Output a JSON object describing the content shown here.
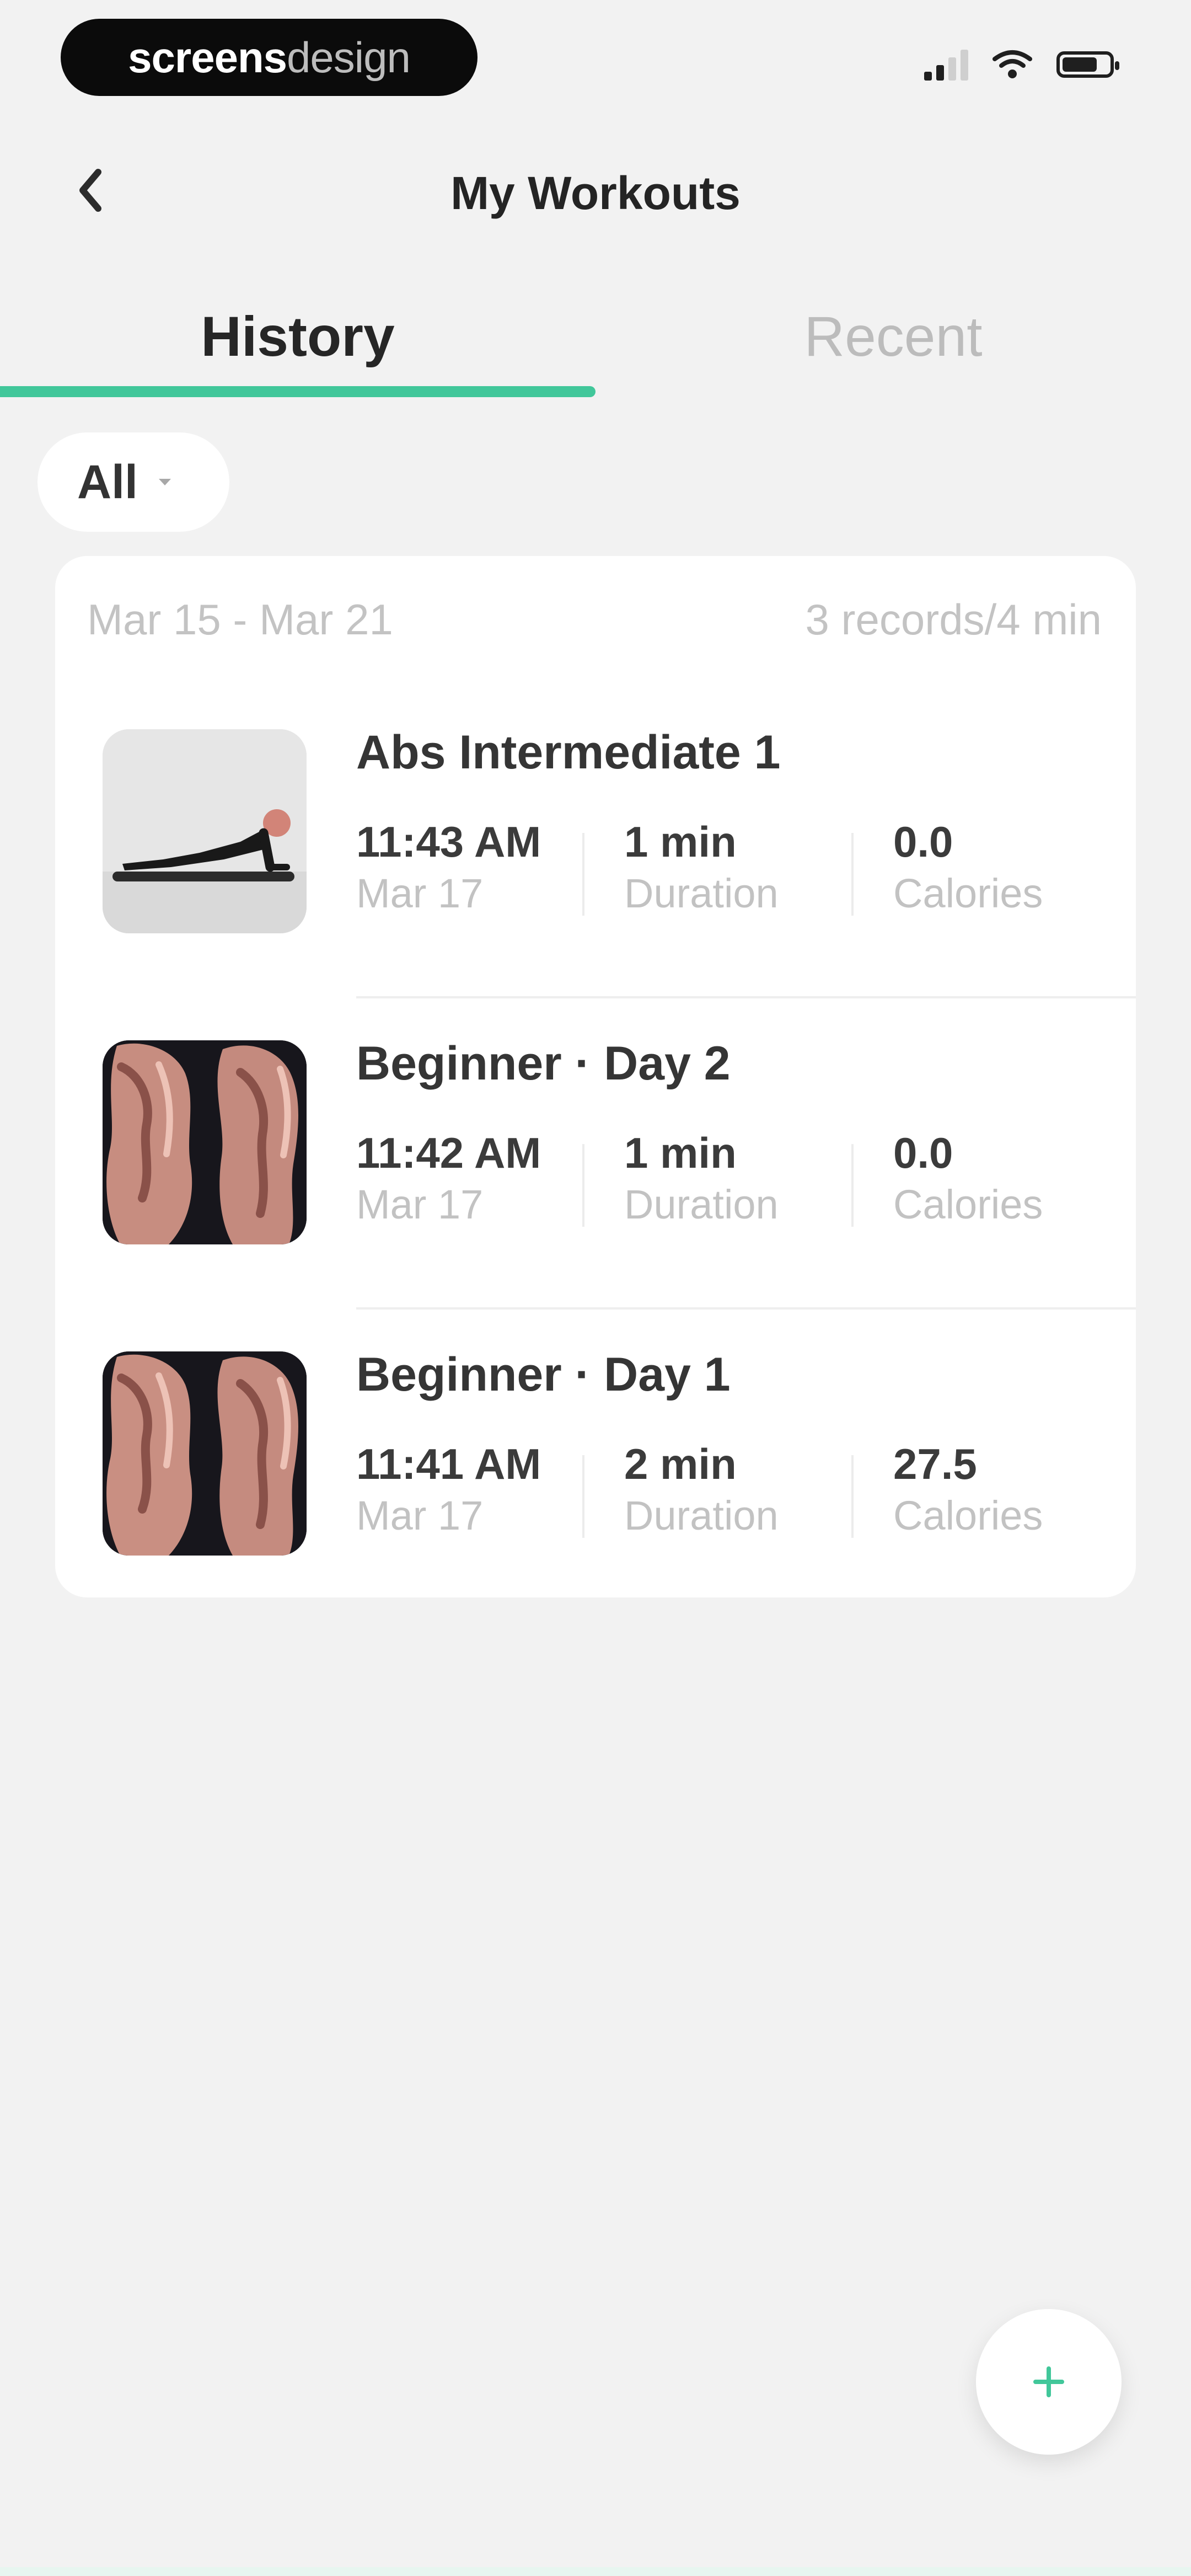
{
  "status_bar": {
    "brand_left": "screens",
    "brand_right": "design",
    "icons": [
      "signal-icon",
      "wifi-icon",
      "battery-icon"
    ]
  },
  "header": {
    "back_icon": "chevron-left-icon",
    "title": "My Workouts"
  },
  "tabs": [
    {
      "label": "History",
      "active": true
    },
    {
      "label": "Recent",
      "active": false
    }
  ],
  "filter": {
    "selected": "All",
    "icon": "caret-down-icon"
  },
  "history": {
    "range": "Mar 15 - Mar 21",
    "summary": "3 records/4 min",
    "items": [
      {
        "title": "Abs Intermediate 1",
        "time": "11:43 AM",
        "date": "Mar 17",
        "duration": "1 min",
        "duration_label": "Duration",
        "calories": "0.0",
        "calories_label": "Calories",
        "thumbnail": "plank-exercise"
      },
      {
        "title": "Beginner · Day 2",
        "time": "11:42 AM",
        "date": "Mar 17",
        "duration": "1 min",
        "duration_label": "Duration",
        "calories": "0.0",
        "calories_label": "Calories",
        "thumbnail": "muscle-arms"
      },
      {
        "title": "Beginner · Day 1",
        "time": "11:41 AM",
        "date": "Mar 17",
        "duration": "2 min",
        "duration_label": "Duration",
        "calories": "27.5",
        "calories_label": "Calories",
        "thumbnail": "muscle-arms"
      }
    ]
  },
  "fab": {
    "icon": "plus-icon"
  },
  "colors": {
    "accent": "#41c79a",
    "background": "#f2f2f2",
    "card": "#ffffff",
    "text_primary": "#242424",
    "text_secondary": "#c3c3c3"
  }
}
